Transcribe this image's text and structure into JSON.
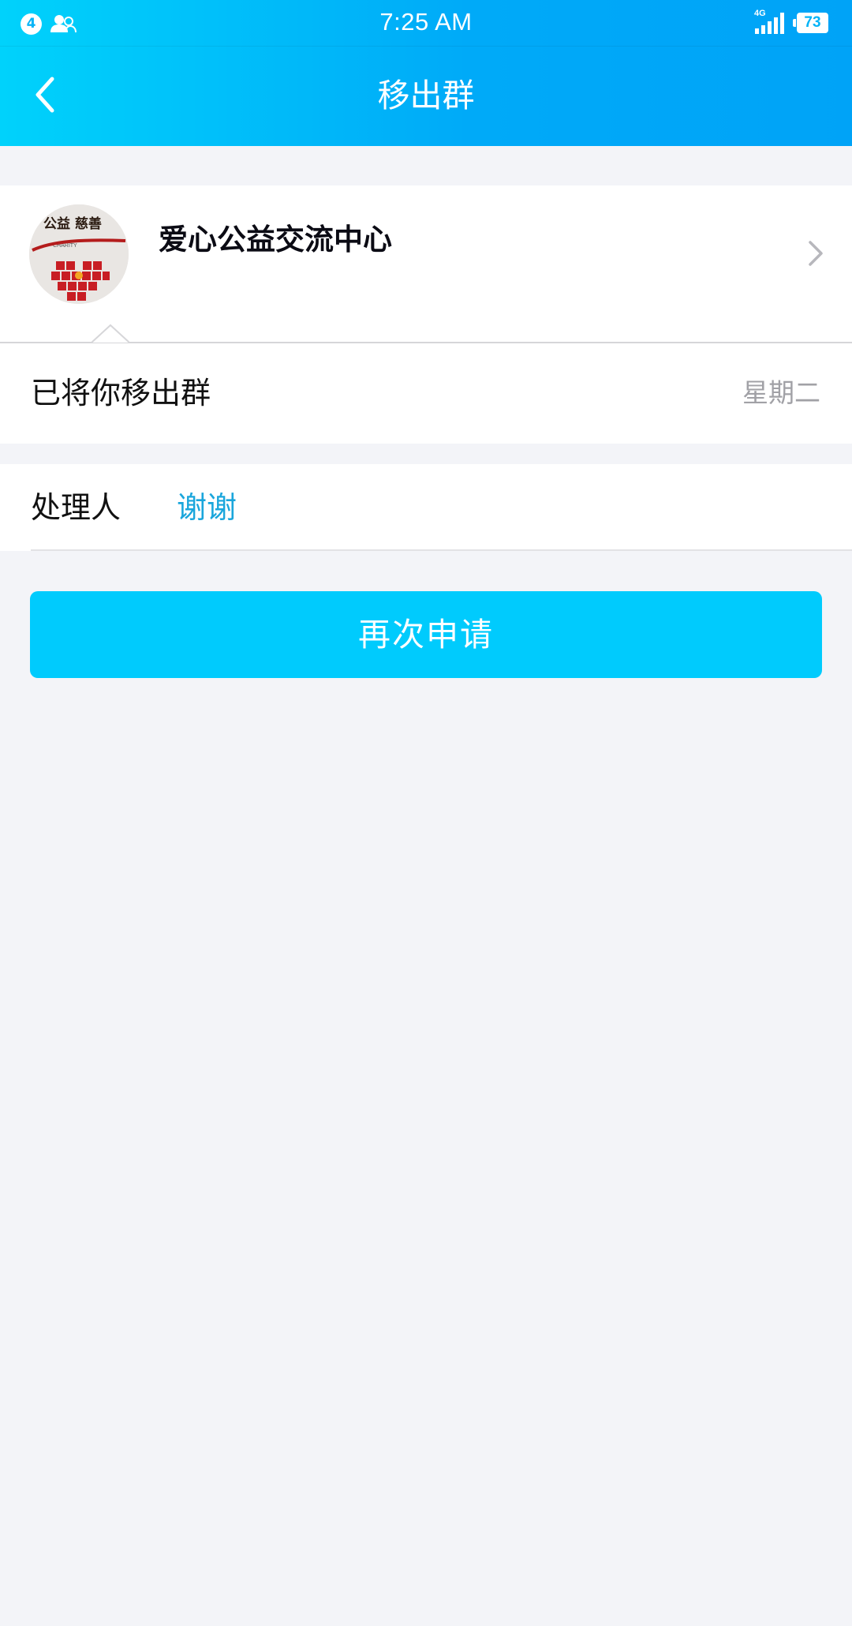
{
  "status_bar": {
    "notification_count": "4",
    "time": "7:25 AM",
    "network": "4G",
    "battery": "73"
  },
  "nav": {
    "title": "移出群"
  },
  "group": {
    "name": "爱心公益交流中心",
    "avatar_text": "公益 慈善",
    "avatar_subtext": "CHARITY"
  },
  "notice": {
    "message": "已将你移出群",
    "time": "星期二"
  },
  "handler": {
    "label": "处理人",
    "name": "谢谢"
  },
  "actions": {
    "reapply_label": "再次申请"
  },
  "colors": {
    "header_start": "#00d2fb",
    "header_end": "#00a3f7",
    "button": "#00cbfd",
    "link": "#1aa6dc",
    "background": "#f3f4f8"
  }
}
